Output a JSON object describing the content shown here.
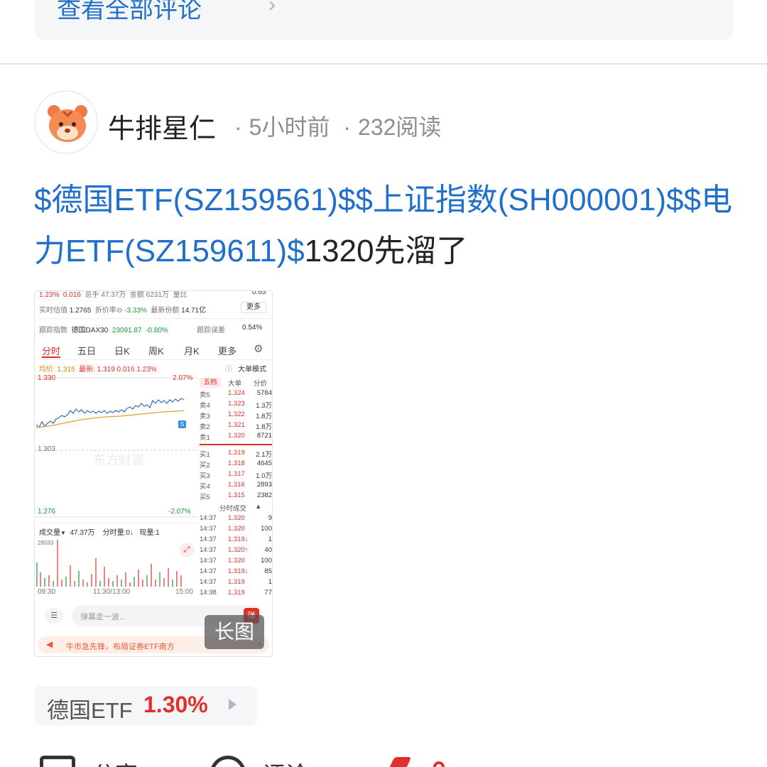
{
  "view_all": {
    "label": "查看全部评论"
  },
  "post": {
    "author": "牛排星仁",
    "time": "5小时前",
    "reads": "232阅读",
    "tag1": "$德国ETF(SZ159561)$",
    "tag2": "$上证指数(SH000001)$",
    "tag3": "$电力ETF(SZ159611)$",
    "body_text": "1320先溜了"
  },
  "screenshot": {
    "top_row": [
      "1.23%",
      "0.016",
      "总手 47.37万",
      "金额 6231万",
      "量比",
      "0.65"
    ],
    "iopv_label": "实时估值",
    "iopv_value": "1.2765",
    "discount_label": "折价率",
    "discount_value": "-3.33%",
    "shares_label": "最新份额",
    "shares_value": "14.71亿",
    "more_label": "更多",
    "track_label": "跟踪指数",
    "track_index": "德国DAX30",
    "track_value": "23091.87",
    "track_pct": "-0.80%",
    "track_err_label": "跟踪误差",
    "track_err_value": "0.54%",
    "tabs": [
      "分时",
      "五日",
      "日K",
      "周K",
      "月K",
      "更多"
    ],
    "avg_label": "均价:",
    "avg_value": "1.315",
    "last_label": "最新:",
    "last_value": "1.319",
    "last_change": "0.016",
    "last_pct": "1.23%",
    "big_mode": "大单模式",
    "y_top": "1.330",
    "y_top_pct": "2.07%",
    "y_mid": "1.303",
    "y_bottom": "1.276",
    "y_bottom_pct": "-2.07%",
    "watermark": "东方财富",
    "ob_tabs": [
      "五档",
      "大单",
      "分价"
    ],
    "asks": [
      {
        "label": "卖5",
        "price": "1.324",
        "vol": "5784"
      },
      {
        "label": "卖4",
        "price": "1.323",
        "vol": "1.3万"
      },
      {
        "label": "卖3",
        "price": "1.322",
        "vol": "1.8万"
      },
      {
        "label": "卖2",
        "price": "1.321",
        "vol": "1.8万"
      },
      {
        "label": "卖1",
        "price": "1.320",
        "vol": "8721"
      }
    ],
    "bids": [
      {
        "label": "买1",
        "price": "1.319",
        "vol": "2.1万"
      },
      {
        "label": "买2",
        "price": "1.318",
        "vol": "4645"
      },
      {
        "label": "买3",
        "price": "1.317",
        "vol": "1.0万"
      },
      {
        "label": "买4",
        "price": "1.316",
        "vol": "2893"
      },
      {
        "label": "买5",
        "price": "1.315",
        "vol": "2382"
      }
    ],
    "ticks_title": "分时成交",
    "ticks": [
      {
        "time": "14:37",
        "price": "1.320",
        "vol": "9"
      },
      {
        "time": "14:37",
        "price": "1.320",
        "vol": "100"
      },
      {
        "time": "14:37",
        "price": "1.319↓",
        "vol": "1"
      },
      {
        "time": "14:37",
        "price": "1.320↑",
        "vol": "40"
      },
      {
        "time": "14:37",
        "price": "1.320",
        "vol": "100"
      },
      {
        "time": "14:37",
        "price": "1.319↓",
        "vol": "85"
      },
      {
        "time": "14:37",
        "price": "1.319",
        "vol": "1"
      },
      {
        "time": "14:38",
        "price": "1.319",
        "vol": "77"
      }
    ],
    "volume_label": "成交量",
    "volume_value": "47.37万",
    "vol_by_label": "分时量:0",
    "cur_vol_label": "现量:1",
    "vol_max": "28593",
    "time_start": "09:30",
    "time_mid": "11:30/13:00",
    "time_end": "15:00",
    "danmu_placeholder": "弹幕走一波...",
    "danmu_btn": "弹",
    "ad_text": "牛市急先锋，布局证券ETF南方",
    "long_image": "长图"
  },
  "stock_chip": {
    "name": "德国ETF",
    "pct": "1.30%"
  },
  "actions": {
    "share": "分享",
    "comment": "评论"
  },
  "colors": {
    "link": "#1f6fcb",
    "up": "#e0302b",
    "down": "#1a9b3a"
  }
}
